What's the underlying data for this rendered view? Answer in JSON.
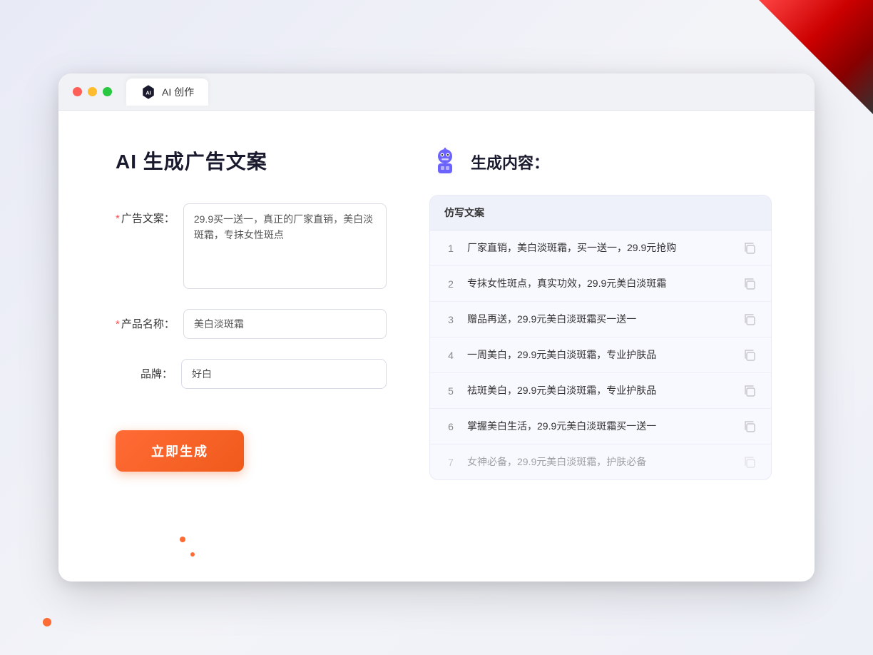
{
  "tab": {
    "label": "AI 创作"
  },
  "page": {
    "title": "AI 生成广告文案"
  },
  "form": {
    "ad_copy_label": "广告文案：",
    "ad_copy_required": "*",
    "ad_copy_value": "29.9买一送一，真正的厂家直销，美白淡斑霜，专抹女性斑点",
    "product_name_label": "产品名称：",
    "product_name_required": "*",
    "product_name_value": "美白淡斑霜",
    "brand_label": "品牌：",
    "brand_value": "好白",
    "generate_btn_label": "立即生成"
  },
  "result": {
    "header": "生成内容：",
    "table_header": "仿写文案",
    "rows": [
      {
        "number": "1",
        "text": "厂家直销，美白淡斑霜，买一送一，29.9元抢购",
        "faded": false
      },
      {
        "number": "2",
        "text": "专抹女性斑点，真实功效，29.9元美白淡斑霜",
        "faded": false
      },
      {
        "number": "3",
        "text": "赠品再送，29.9元美白淡斑霜买一送一",
        "faded": false
      },
      {
        "number": "4",
        "text": "一周美白，29.9元美白淡斑霜，专业护肤品",
        "faded": false
      },
      {
        "number": "5",
        "text": "祛斑美白，29.9元美白淡斑霜，专业护肤品",
        "faded": false
      },
      {
        "number": "6",
        "text": "掌握美白生活，29.9元美白淡斑霜买一送一",
        "faded": false
      },
      {
        "number": "7",
        "text": "女神必备，29.9元美白淡斑霜，护肤必备",
        "faded": true
      }
    ]
  }
}
